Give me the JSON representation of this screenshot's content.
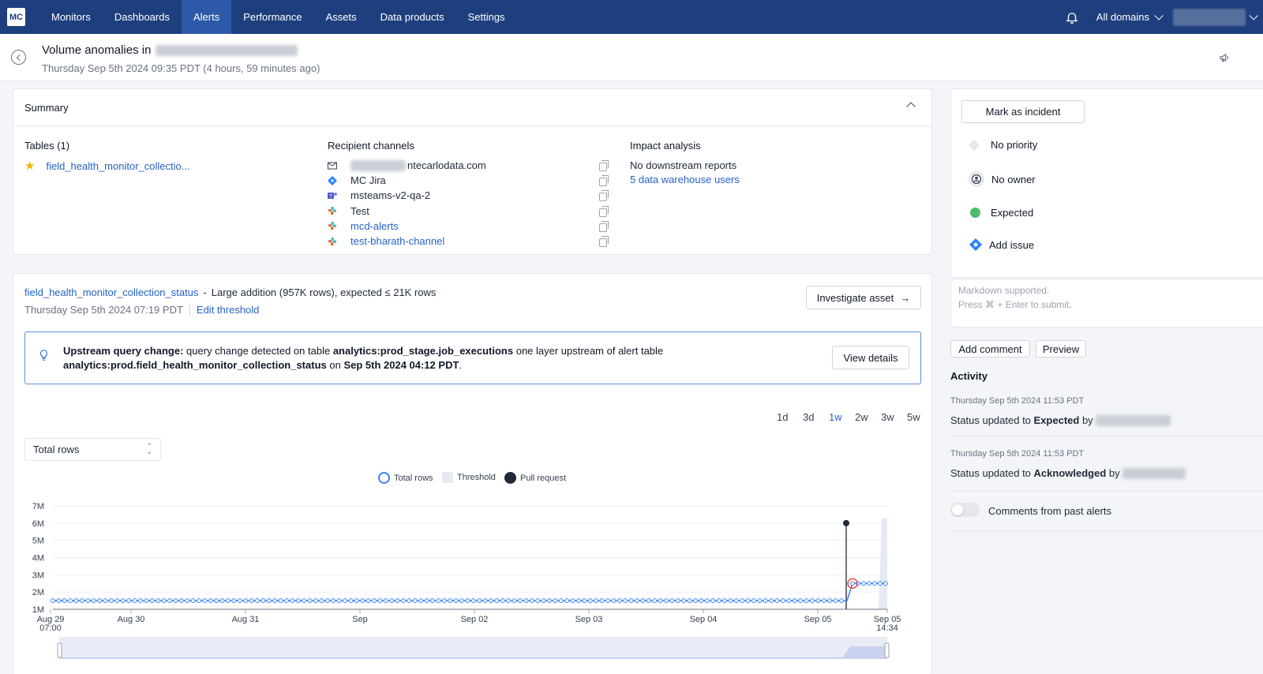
{
  "nav": {
    "logo": "MC",
    "items": [
      "Monitors",
      "Dashboards",
      "Alerts",
      "Performance",
      "Assets",
      "Data products",
      "Settings"
    ],
    "active_index": 2,
    "domains_label": "All domains"
  },
  "header": {
    "title": "Volume anomalies in",
    "subtitle": "Thursday Sep 5th 2024 09:35 PDT (4 hours, 59 minutes ago)"
  },
  "summary": {
    "title": "Summary",
    "tables_header": "Tables (1)",
    "table_name": "field_health_monitor_collectio...",
    "recipients_header": "Recipient channels",
    "recipients": [
      {
        "label": "ntecarlodata.com",
        "icon": "email-icon",
        "link": false
      },
      {
        "label": "MC Jira",
        "icon": "jira-icon",
        "link": false
      },
      {
        "label": "msteams-v2-qa-2",
        "icon": "msteams-icon",
        "link": false
      },
      {
        "label": "Test",
        "icon": "slack-icon",
        "link": false
      },
      {
        "label": "mcd-alerts",
        "icon": "slack-icon",
        "link": true
      },
      {
        "label": "test-bharath-channel",
        "icon": "slack-icon",
        "link": true
      }
    ],
    "impact_header": "Impact analysis",
    "impact_line1": "No downstream reports",
    "impact_line2": "5 data warehouse users"
  },
  "right_panel": {
    "mark_incident": "Mark as incident",
    "priority": "No priority",
    "owner": "No owner",
    "status": "Expected",
    "status_color": "#4cbb6c",
    "add_issue": "Add issue",
    "comment_placeholder_1": "Markdown supported.",
    "comment_placeholder_2": "Press ⌘ + Enter to submit.",
    "add_comment": "Add comment",
    "preview": "Preview",
    "activity_title": "Activity",
    "activity": [
      {
        "time": "Thursday Sep 5th 2024 11:53 PDT",
        "prefix": "Status updated to ",
        "status": "Expected",
        "by": " by "
      },
      {
        "time": "Thursday Sep 5th 2024 11:53 PDT",
        "prefix": "Status updated to ",
        "status": "Acknowledged",
        "by": " by "
      }
    ],
    "past_alerts_label": "Comments from past alerts"
  },
  "alert": {
    "table_link": "field_health_monitor_collection_status",
    "separator": "-",
    "description": "Large addition (957K rows), expected ≤ 21K rows",
    "time": "Thursday Sep 5th 2024 07:19 PDT",
    "edit_threshold": "Edit threshold",
    "investigate": "Investigate asset",
    "upstream": {
      "bold_lead": "Upstream query change:",
      "text1": " query change detected on table ",
      "table1": "analytics:prod_stage.job_executions",
      "text2": " one layer upstream of alert table",
      "table2": "analytics:prod.field_health_monitor_collection_status",
      "text3": " on ",
      "date": "Sep 5th 2024 04:12 PDT",
      "text4": ".",
      "view_details": "View details"
    },
    "ranges": [
      "1d",
      "3d",
      "1w",
      "2w",
      "3w",
      "5w"
    ],
    "active_range": "1w",
    "metric_select": "Total rows",
    "legend": {
      "total_rows": "Total rows",
      "threshold": "Threshold",
      "pull_request": "Pull request"
    }
  },
  "chart_data": {
    "type": "line",
    "series": [
      {
        "name": "Total rows",
        "color": "#3b82f6",
        "baseline": 1500000,
        "jump_value": 2500000
      },
      {
        "name": "Threshold",
        "color": "#e5eaf3"
      },
      {
        "name": "Pull request",
        "color": "#1f2937",
        "value": 6000000
      }
    ],
    "y_ticks": [
      "1M",
      "2M",
      "3M",
      "4M",
      "5M",
      "6M",
      "7M"
    ],
    "ylim": [
      1000000,
      7000000
    ],
    "x_ticks": [
      {
        "line1": "Aug 29",
        "line2": "07:00"
      },
      {
        "line1": "Aug 30",
        "line2": ""
      },
      {
        "line1": "Aug 31",
        "line2": ""
      },
      {
        "line1": "Sep",
        "line2": ""
      },
      {
        "line1": "Sep 02",
        "line2": ""
      },
      {
        "line1": "Sep 03",
        "line2": ""
      },
      {
        "line1": "Sep 04",
        "line2": ""
      },
      {
        "line1": "Sep 05",
        "line2": ""
      },
      {
        "line1": "Sep 05",
        "line2": "14:34"
      }
    ]
  }
}
